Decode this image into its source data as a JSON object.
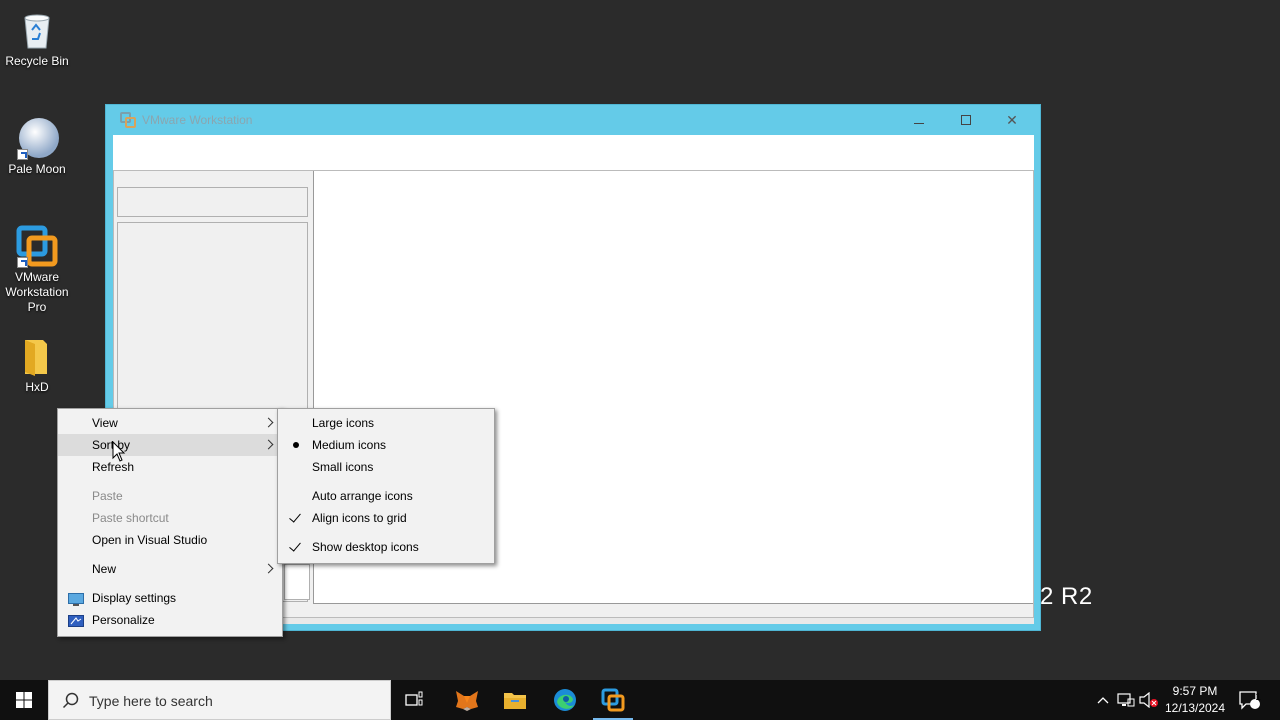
{
  "desktop": {
    "icons": [
      {
        "label": "Recycle Bin",
        "icon": "recycle-bin-icon"
      },
      {
        "label": "Pale Moon",
        "icon": "pale-moon-icon"
      },
      {
        "label": "VMware Workstation Pro",
        "icon": "vmware-icon"
      },
      {
        "label": "HxD",
        "icon": "folder-icon"
      }
    ],
    "watermark": "2 R2"
  },
  "vmware_window": {
    "title": "VMware Workstation"
  },
  "context_menu": {
    "items": [
      {
        "label": "View",
        "submenu": true,
        "disabled": false
      },
      {
        "label": "Sort by",
        "submenu": true,
        "disabled": false,
        "highlighted": true
      },
      {
        "label": "Refresh",
        "disabled": false
      },
      {
        "label": "Paste",
        "disabled": true
      },
      {
        "label": "Paste shortcut",
        "disabled": true
      },
      {
        "label": "Open in Visual Studio",
        "disabled": false
      },
      {
        "label": "New",
        "submenu": true,
        "disabled": false
      },
      {
        "label": "Display settings",
        "icon": "display-settings-icon",
        "disabled": false
      },
      {
        "label": "Personalize",
        "icon": "personalize-icon",
        "disabled": false
      }
    ]
  },
  "view_submenu": {
    "items": [
      {
        "label": "Large icons",
        "mark": "none"
      },
      {
        "label": "Medium icons",
        "mark": "bullet"
      },
      {
        "label": "Small icons",
        "mark": "none"
      },
      {
        "label": "Auto arrange icons",
        "mark": "none"
      },
      {
        "label": "Align icons to grid",
        "mark": "check"
      },
      {
        "label": "Show desktop icons",
        "mark": "check"
      }
    ]
  },
  "taskbar": {
    "search_placeholder": "Type here to search",
    "apps": [
      "task-view-icon",
      "metamask-fox-icon",
      "file-explorer-icon",
      "edge-icon",
      "vmware-icon"
    ],
    "active_app": "vmware-icon",
    "clock_time": "9:57 PM",
    "clock_date": "12/13/2024",
    "notification_count": "1"
  },
  "colors": {
    "desktop_bg": "#2b2b2b",
    "vm_frame": "#64cbe8",
    "taskbar_bg": "#101010",
    "menu_bg": "#f2f2f2"
  }
}
